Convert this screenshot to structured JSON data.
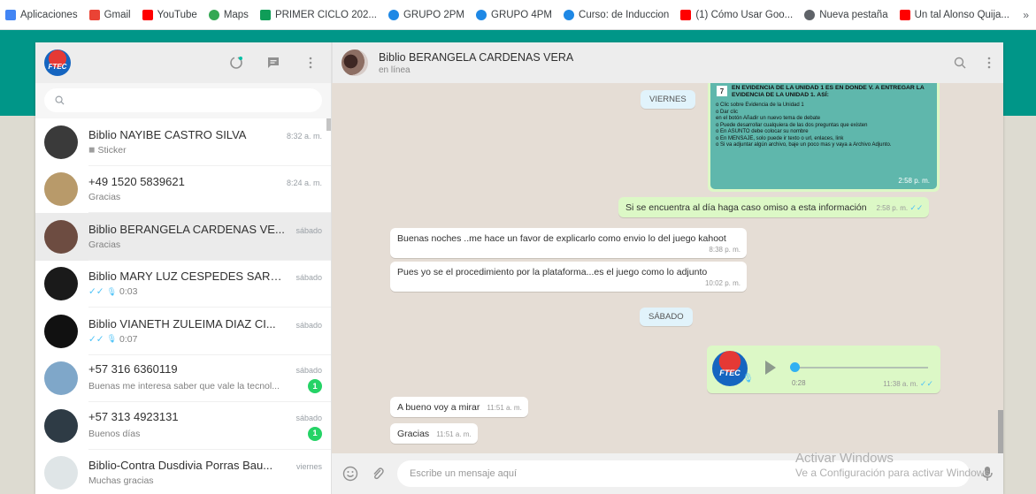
{
  "bookmarks": [
    {
      "label": "Aplicaciones",
      "icon": "apps-grid-icon",
      "color": "#4285f4"
    },
    {
      "label": "Gmail",
      "icon": "gmail-icon",
      "color": "#ea4335"
    },
    {
      "label": "YouTube",
      "icon": "youtube-icon",
      "color": "#ff0000"
    },
    {
      "label": "Maps",
      "icon": "maps-pin-icon",
      "color": "#34a853"
    },
    {
      "label": "PRIMER CICLO 202...",
      "icon": "classroom-icon",
      "color": "#0f9d58"
    },
    {
      "label": "GRUPO 2PM",
      "icon": "group-icon",
      "color": "#1e88e5"
    },
    {
      "label": "GRUPO 4PM",
      "icon": "group-icon",
      "color": "#1e88e5"
    },
    {
      "label": "Curso: de Induccion",
      "icon": "group-icon",
      "color": "#1e88e5"
    },
    {
      "label": "(1) Cómo Usar Goo...",
      "icon": "youtube-icon",
      "color": "#ff0000"
    },
    {
      "label": "Nueva pestaña",
      "icon": "globe-icon",
      "color": "#5f6368"
    },
    {
      "label": "Un tal Alonso Quija...",
      "icon": "youtube-icon",
      "color": "#ff0000"
    }
  ],
  "bookmarks_more": "»",
  "sidebar": {
    "avatar_text": "FTEC",
    "search_placeholder": "",
    "chats": [
      {
        "name": "Biblio NAYIBE CASTRO SILVA",
        "time": "8:32 a. m.",
        "preview": "Sticker",
        "preview_icon": "sticker-icon",
        "avatar_color": "#3a3a3a",
        "badge": ""
      },
      {
        "name": "+49 1520 5839621",
        "time": "8:24 a. m.",
        "preview": "Gracias",
        "avatar_color": "#b89a6a",
        "badge": ""
      },
      {
        "name": "Biblio BERANGELA CARDENAS VE...",
        "time": "sábado",
        "preview": "Gracias",
        "avatar_color": "#6d4c41",
        "badge": "",
        "active": true
      },
      {
        "name": "Biblio MARY LUZ CESPEDES SARM...",
        "time": "sábado",
        "preview": "0:03",
        "preview_ticks": "✓✓",
        "preview_icon": "mic-icon",
        "avatar_color": "#1a1a1a",
        "badge": ""
      },
      {
        "name": "Biblio VIANETH ZULEIMA DIAZ CI...",
        "time": "sábado",
        "preview": "0:07",
        "preview_ticks": "✓✓",
        "preview_icon": "mic-icon",
        "avatar_color": "#111111",
        "badge": ""
      },
      {
        "name": "+57 316 6360119",
        "time": "sábado",
        "preview": "Buenas me interesa saber que vale la tecnol...",
        "avatar_color": "#7fa7c9",
        "badge": "1"
      },
      {
        "name": "+57 313 4923131",
        "time": "sábado",
        "preview": "Buenos días",
        "avatar_color": "#2e3b45",
        "badge": "1"
      },
      {
        "name": "Biblio-Contra Dusdivia  Porras Bau...",
        "time": "viernes",
        "preview": "Muchas gracias",
        "avatar_color": "#dfe5e7",
        "badge": ""
      }
    ]
  },
  "conversation": {
    "name": "Biblio BERANGELA CARDENAS VERA",
    "status": "en línea",
    "image_message": {
      "number": "7",
      "heading": "EN EVIDENCIA DE LA UNIDAD 1 ES EN DONDE V. A ENTREGAR LA EVIDENCIA DE LA UNIDAD 1. ASÍ:",
      "lines": [
        "o  Clic sobre Evidencia de la Unidad 1",
        "o  Dar clic",
        "en el botón Añadir un nuevo tema de debate",
        "o  Puede desarrollar cualquiera de las dos preguntas que existen",
        "o  En ASUNTO debe colocar su nombre",
        "o  En MENSAJE, solo puede ir texto o url, enlaces, link",
        "o  Si va adjuntar algún archivo, baje un poco mas y vaya a Archivo Adjunto."
      ],
      "time": "2:58 p. m."
    },
    "day_viernes": "VIERNES",
    "day_sabado": "SÁBADO",
    "msg_out_1": {
      "text": "Si se encuentra al día haga caso omiso a esta información",
      "time": "2:58 p. m.",
      "ticks": "✓✓"
    },
    "msg_in_1": {
      "text": "Buenas noches ..me hace un favor de explicarlo como envio lo del juego kahoot",
      "time": "8:38 p. m."
    },
    "msg_in_2": {
      "text": "Pues yo se el procedimiento por la plataforma...es el juego como lo adjunto",
      "time": "10:02 p. m."
    },
    "audio": {
      "duration": "0:28",
      "time": "11:38 a. m.",
      "ticks": "✓✓",
      "avatar_text": "FTEC"
    },
    "msg_in_3": {
      "text": "A bueno voy a mirar",
      "time": "11:51 a. m."
    },
    "msg_in_4": {
      "text": "Gracias",
      "time": "11:51 a. m."
    },
    "input_placeholder": "Escribe un mensaje aquí"
  },
  "watermark": {
    "line1": "Activar Windows",
    "line2": "Ve a Configuración para activar Windows."
  },
  "colors": {
    "accent": "#009688",
    "out_bubble": "#dcf8c6",
    "chat_bg": "#e5ddd5",
    "badge": "#25d366"
  }
}
